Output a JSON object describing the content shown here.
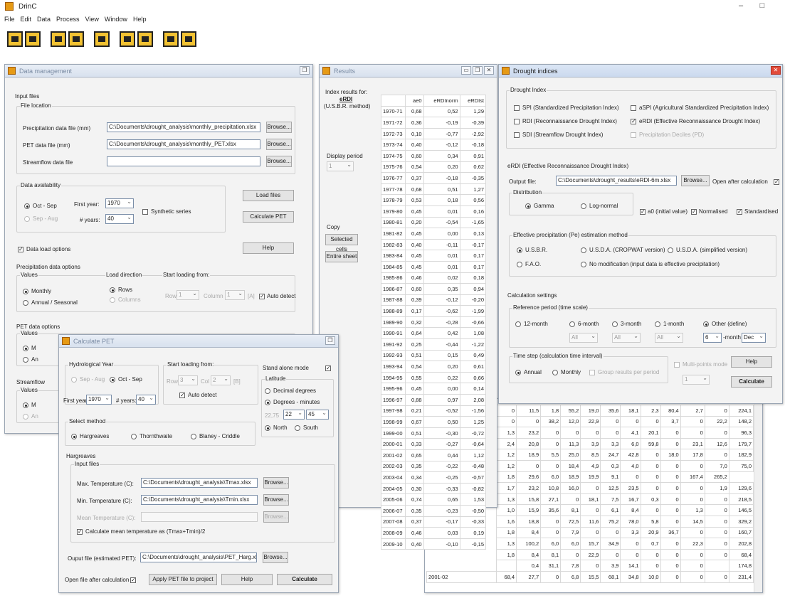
{
  "app": {
    "title": "DrinC",
    "minimize": "–",
    "maximize": "□"
  },
  "menu": [
    "File",
    "Edit",
    "Data",
    "Process",
    "View",
    "Window",
    "Help"
  ],
  "toolbar": {
    "icons": [
      "open-icon",
      "save-icon",
      "search-icon",
      "pet-icon",
      "chart-icon",
      "calc-icon",
      "table-icon",
      "help-icon",
      "list-icon"
    ]
  },
  "data_mgmt": {
    "title": "Data management",
    "input_files": "Input files",
    "file_location": "File location",
    "precip_label": "Precipitation data file (mm)",
    "precip_value": "C:\\Documents\\drought_analysis\\monthly_precipitation.xlsx",
    "pet_label": "PET data file (mm)",
    "pet_value": "C:\\Documents\\drought_analysis\\monthly_PET.xlsx",
    "stream_label": "Streamflow data file",
    "stream_value": "",
    "browse": "Browse...",
    "availability": "Data availability",
    "oct_sep": "Oct - Sep",
    "sep_aug": "Sep - Aug",
    "first_year_label": "First year:",
    "first_year": "1970",
    "nyears_label": "# years:",
    "nyears": "40",
    "synthetic": "Synthetic series",
    "load_files": "Load files",
    "calc_pet": "Calculate PET",
    "load_options": "Data load options",
    "help": "Help",
    "precip_options": "Precipitation data options",
    "values": "Values",
    "monthly": "Monthly",
    "annual": "Annual / Seasonal",
    "load_direction": "Load direction",
    "rows": "Rows",
    "columns": "Columns",
    "start_from": "Start loading from:",
    "row_lbl": "Row",
    "row_val": "1",
    "col_lbl": "Column",
    "col_val": "1",
    "col_letter": "[A]",
    "auto_detect": "Auto detect",
    "pet_options": "PET data options",
    "values_short": "Values",
    "m_short": "M",
    "a_short": "An",
    "stream_short": "Streamflow",
    "v_short": "Values"
  },
  "results": {
    "title": "Results",
    "index_for": "Index results for:",
    "index_name": "eRDI",
    "method": "(U.S.B.R. method)",
    "display_period": "Display period",
    "period": "1",
    "copy": "Copy",
    "selected_cells": "Selected cells",
    "entire_sheet": "Entire sheet",
    "headers": [
      "",
      "ae0",
      "eRDInorm",
      "eRDIst"
    ],
    "rows": [
      [
        "1970-71",
        "0,68",
        "0,52",
        "1,29"
      ],
      [
        "1971-72",
        "0,36",
        "-0,19",
        "-0,39"
      ],
      [
        "1972-73",
        "0,10",
        "-0,77",
        "-2,92"
      ],
      [
        "1973-74",
        "0,40",
        "-0,12",
        "-0,18"
      ],
      [
        "1974-75",
        "0,60",
        "0,34",
        "0,91"
      ],
      [
        "1975-76",
        "0,54",
        "0,20",
        "0,62"
      ],
      [
        "1976-77",
        "0,37",
        "-0,18",
        "-0,35"
      ],
      [
        "1977-78",
        "0,68",
        "0,51",
        "1,27"
      ],
      [
        "1978-79",
        "0,53",
        "0,18",
        "0,56"
      ],
      [
        "1979-80",
        "0,45",
        "0,01",
        "0,16"
      ],
      [
        "1980-81",
        "0,20",
        "-0,54",
        "-1,65"
      ],
      [
        "1981-82",
        "0,45",
        "0,00",
        "0,13"
      ],
      [
        "1982-83",
        "0,40",
        "-0,11",
        "-0,17"
      ],
      [
        "1983-84",
        "0,45",
        "0,01",
        "0,17"
      ],
      [
        "1984-85",
        "0,45",
        "0,01",
        "0,17"
      ],
      [
        "1985-86",
        "0,46",
        "0,02",
        "0,18"
      ],
      [
        "1986-87",
        "0,60",
        "0,35",
        "0,94"
      ],
      [
        "1987-88",
        "0,39",
        "-0,12",
        "-0,20"
      ],
      [
        "1988-89",
        "0,17",
        "-0,62",
        "-1,99"
      ],
      [
        "1989-90",
        "0,32",
        "-0,28",
        "-0,66"
      ],
      [
        "1990-91",
        "0,64",
        "0,42",
        "1,08"
      ],
      [
        "1991-92",
        "0,25",
        "-0,44",
        "-1,22"
      ],
      [
        "1992-93",
        "0,51",
        "0,15",
        "0,49"
      ],
      [
        "1993-94",
        "0,54",
        "0,20",
        "0,61"
      ],
      [
        "1994-95",
        "0,55",
        "0,22",
        "0,66"
      ],
      [
        "1995-96",
        "0,45",
        "0,00",
        "0,14"
      ],
      [
        "1996-97",
        "0,88",
        "0,97",
        "2,08"
      ],
      [
        "1997-98",
        "0,21",
        "-0,52",
        "-1,56"
      ],
      [
        "1998-99",
        "0,67",
        "0,50",
        "1,25"
      ],
      [
        "1999-00",
        "0,51",
        "-0,30",
        "-0,72"
      ],
      [
        "2000-01",
        "0,33",
        "-0,27",
        "-0,64"
      ],
      [
        "2001-02",
        "0,65",
        "0,44",
        "1,12"
      ],
      [
        "2002-03",
        "0,35",
        "-0,22",
        "-0,48"
      ],
      [
        "2003-04",
        "0,34",
        "-0,25",
        "-0,57"
      ],
      [
        "2004-05",
        "0,30",
        "-0,33",
        "-0,82"
      ],
      [
        "2005-06",
        "0,74",
        "0,65",
        "1,53"
      ],
      [
        "2006-07",
        "0,35",
        "-0,23",
        "-0,50"
      ],
      [
        "2007-08",
        "0,37",
        "-0,17",
        "-0,33"
      ],
      [
        "2008-09",
        "0,46",
        "0,03",
        "0,19"
      ],
      [
        "2009-10",
        "0,40",
        "-0,10",
        "-0,15"
      ]
    ]
  },
  "backsheet": {
    "rows": [
      [
        "0",
        "11,5",
        "1,8",
        "55,2",
        "19,0",
        "35,6",
        "18,1",
        "2,3",
        "80,4",
        "2,7",
        "0",
        "224,1"
      ],
      [
        "0",
        "0",
        "38,2",
        "12,0",
        "22,9",
        "0",
        "0",
        "0",
        "3,7",
        "0",
        "22,2",
        "148,2"
      ],
      [
        "1,3",
        "23,2",
        "0",
        "0",
        "0",
        "0",
        "4,1",
        "20,1",
        "0",
        "0",
        "0",
        "96,3"
      ],
      [
        "2,4",
        "20,8",
        "0",
        "11,3",
        "3,9",
        "3,3",
        "6,0",
        "59,8",
        "0",
        "23,1",
        "12,6",
        "179,7"
      ],
      [
        "1,2",
        "18,9",
        "5,5",
        "25,0",
        "8,5",
        "24,7",
        "42,8",
        "0",
        "18,0",
        "17,8",
        "0",
        "182,9"
      ],
      [
        "1,2",
        "0",
        "0",
        "18,4",
        "4,9",
        "0,3",
        "4,0",
        "0",
        "0",
        "0",
        "7,0",
        "75,0"
      ],
      [
        "1,8",
        "29,6",
        "6,0",
        "18,9",
        "19,9",
        "9,1",
        "0",
        "0",
        "0",
        "167,4",
        "265,2"
      ],
      [
        "1,7",
        "23,2",
        "10,8",
        "16,0",
        "0",
        "12,5",
        "23,5",
        "0",
        "0",
        "0",
        "1,9",
        "129,6"
      ],
      [
        "1,3",
        "15,8",
        "27,1",
        "0",
        "18,1",
        "7,5",
        "16,7",
        "0,3",
        "0",
        "0",
        "0",
        "218,5"
      ],
      [
        "1,0",
        "15,9",
        "35,6",
        "8,1",
        "0",
        "6,1",
        "8,4",
        "0",
        "0",
        "1,3",
        "0",
        "146,5"
      ],
      [
        "1,6",
        "18,8",
        "0",
        "72,5",
        "11,6",
        "75,2",
        "78,0",
        "5,8",
        "0",
        "14,5",
        "0",
        "329,2"
      ],
      [
        "1,8",
        "8,4",
        "0",
        "7,9",
        "0",
        "0",
        "3,3",
        "20,9",
        "36,7",
        "0",
        "0",
        "160,7"
      ],
      [
        "1,3",
        "100,2",
        "6,0",
        "6,0",
        "15,7",
        "34,9",
        "0",
        "0,7",
        "0",
        "22,3",
        "0",
        "202,8"
      ],
      [
        "1,8",
        "8,4",
        "8,1",
        "0",
        "22,9",
        "0",
        "0",
        "0",
        "0",
        "0",
        "0",
        "68,4"
      ],
      [
        "",
        "0,4",
        "31,1",
        "7,8",
        "0",
        "3,9",
        "14,1",
        "0",
        "0",
        "0",
        "",
        "174,8"
      ]
    ],
    "extra_row": [
      "2001-02",
      "68,4",
      "27,7",
      "0",
      "6,8",
      "15,5",
      "68,1",
      "34,8",
      "10,0",
      "0",
      "0",
      "0",
      "231,4"
    ]
  },
  "drought": {
    "title": "Drought indices",
    "group": "Drought Index",
    "spi": "SPI (Standardized Precipitation Index)",
    "rdi": "RDI (Reconnaissance Drought Index)",
    "sdi": "SDI (Streamflow Drought Index)",
    "aspi": "aSPI (Agricultural Standardized Precipitation Index)",
    "erdi": "eRDI (Effective Reconnaissance Drought Index)",
    "pd": "Precipitation Deciles (PD)",
    "erdi_group": "eRDI (Effective Reconnaissance Drought Index)",
    "output_label": "Output file:",
    "output_value": "C:\\Documents\\drought_results\\eRDI-6m.xlsx",
    "browse": "Browse...",
    "open_after": "Open after calculation",
    "distribution": "Distribution",
    "gamma": "Gamma",
    "lognormal": "Log-normal",
    "a0": "a0 (initial value)",
    "normalised": "Normalised",
    "standardised": "Standardised",
    "pe_method": "Effective precipitation (Pe) estimation method",
    "usbr": "U.S.B.R.",
    "usda_crop": "U.S.D.A. (CROPWAT version)",
    "usda_simp": "U.S.D.A. (simplified version)",
    "fao": "F.A.O.",
    "nomod": "No modification (input data is effective precipitation)",
    "calc_settings": "Calculation settings",
    "ref_period": "Reference period (time scale)",
    "m12": "12-month",
    "m6": "6-month",
    "m3": "3-month",
    "m1": "1-month",
    "other": "Other (define)",
    "all": "All",
    "six": "6",
    "month_lbl": "-month",
    "dec": "Dec",
    "time_step": "Time step (calculation time interval)",
    "annual": "Annual",
    "monthly": "Monthly",
    "group_results": "Group results per period",
    "multipoints": "Multi-points mode",
    "one": "1",
    "help": "Help",
    "calculate": "Calculate"
  },
  "pet": {
    "title": "Calculate PET",
    "hydro": "Hydrological Year",
    "sep_aug": "Sep - Aug",
    "oct_sep": "Oct - Sep",
    "first_year_label": "First year:",
    "first_year": "1970",
    "nyears_label": "# years:",
    "nyears": "40",
    "start_from": "Start loading from:",
    "row_lbl": "Row",
    "row_val": "3",
    "col_lbl": "Col",
    "col_val": "2",
    "col_letter": "[B]",
    "auto_detect": "Auto detect",
    "standalone": "Stand alone mode",
    "latitude": "Latitude",
    "decimal": "Decimal degrees",
    "degmin": "Degrees - minutes",
    "deg_dec": "22,75",
    "deg": "22",
    "min": "45",
    "north": "North",
    "south": "South",
    "select_method": "Select method",
    "hargreaves": "Hargreaves",
    "thornthwaite": "Thornthwaite",
    "blaney": "Blaney - Criddle",
    "harg_group": "Hargreaves",
    "input_files": "Input files",
    "tmax_label": "Max. Temperature (C):",
    "tmax_value": "C:\\Documents\\drought_analysis\\Tmax.xlsx",
    "tmin_label": "Min. Temperature (C):",
    "tmin_value": "C:\\Documents\\drought_analysis\\Tmin.xlsx",
    "tmean_label": "Mean Temperature (C):",
    "tmean_value": "",
    "calc_mean": "Calculate mean temperature as (Tmax+Tmin)/2",
    "output_label": "Ouput file (estimated PET):",
    "output_value": "C:\\Documents\\drought_analysis\\PET_Harg.xlsx",
    "browse": "Browse...",
    "open_after": "Open file after calculation",
    "apply": "Apply PET file to project",
    "help": "Help",
    "calculate": "Calculate"
  }
}
